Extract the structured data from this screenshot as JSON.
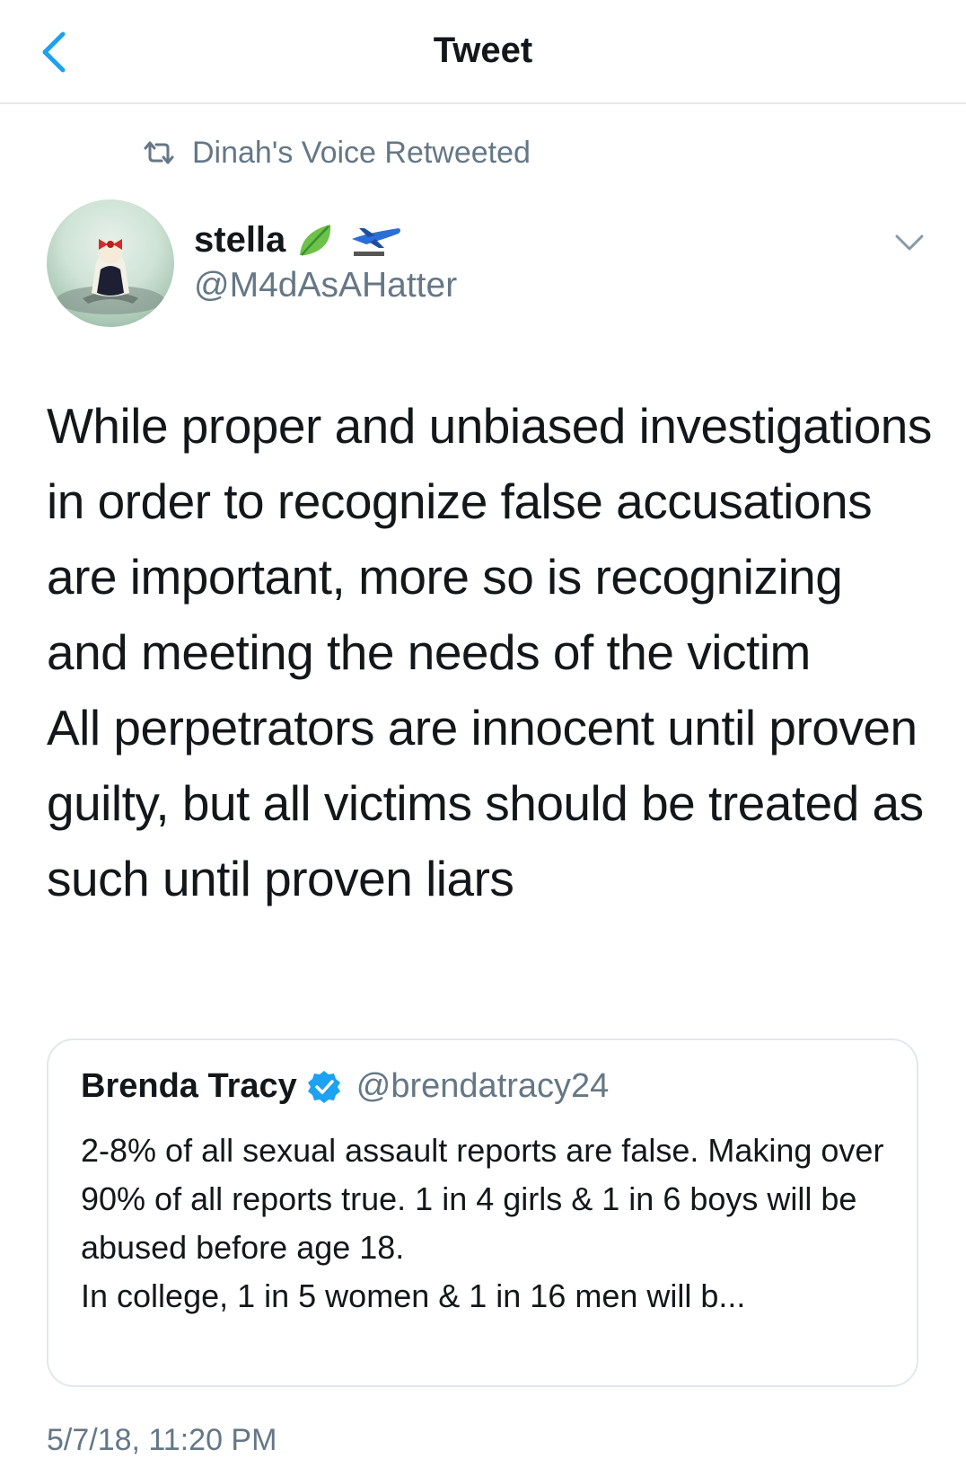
{
  "nav": {
    "title": "Tweet"
  },
  "retweet": {
    "text": "Dinah's Voice Retweeted"
  },
  "author": {
    "name": "stella",
    "handle": "@M4dAsAHatter",
    "name_emojis": [
      "leaf-emoji",
      "airplane-emoji"
    ]
  },
  "tweet": {
    "text": "While proper and unbiased investigations in order to recognize false accusations are important, more so is recognizing and meeting the needs of the victim\nAll perpetrators are innocent until proven guilty, but all victims should be treated as such until proven liars"
  },
  "quote": {
    "name": "Brenda Tracy",
    "handle": "@brendatracy24",
    "text": "2-8% of all sexual assault reports are false. Making over 90% of all reports true. 1 in 4 girls & 1 in 6 boys will be abused before age 18.\nIn college, 1 in 5  women & 1 in 16 men will b..."
  },
  "timestamp": "5/7/18, 11:20 PM",
  "colors": {
    "accent": "#1da1f2",
    "secondary_text": "#657786",
    "border": "#e1e8ed"
  }
}
